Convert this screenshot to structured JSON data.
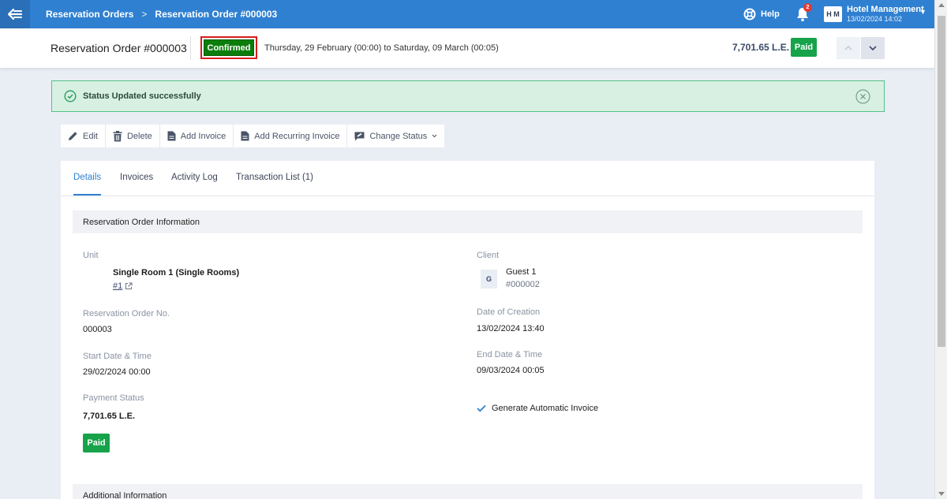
{
  "topbar": {
    "breadcrumbs": [
      "Reservation Orders",
      "Reservation Order #000003"
    ],
    "breadcrumb_separator": ">",
    "help_label": "Help",
    "notification_count": "2",
    "user_initials": "H M",
    "user_name": "Hotel Management",
    "user_datetime": "13/02/2024 14:02"
  },
  "header": {
    "title": "Reservation Order #000003",
    "status": "Confirmed",
    "date_range": "Thursday, 29 February (00:00) to Saturday, 09 March (00:05)",
    "total": "7,701.65 L.E.",
    "payment_badge": "Paid"
  },
  "alert": {
    "message": "Status Updated successfully"
  },
  "toolbar": {
    "edit": "Edit",
    "delete": "Delete",
    "add_invoice": "Add Invoice",
    "add_recurring_invoice": "Add Recurring Invoice",
    "change_status": "Change Status"
  },
  "tabs": [
    "Details",
    "Invoices",
    "Activity Log",
    "Transaction List (1)"
  ],
  "details": {
    "section_title": "Reservation Order Information",
    "unit_label": "Unit",
    "unit_name": "Single Room 1 (Single Rooms)",
    "unit_link": "#1",
    "client_label": "Client",
    "client_initial": "G",
    "client_name": "Guest 1",
    "client_id": "#000002",
    "order_no_label": "Reservation Order No.",
    "order_no": "000003",
    "creation_label": "Date of Creation",
    "creation_date": "13/02/2024 13:40",
    "start_label": "Start Date & Time",
    "start_date": "29/02/2024 00:00",
    "end_label": "End Date & Time",
    "end_date": "09/03/2024 00:05",
    "payment_status_label": "Payment Status",
    "payment_amount": "7,701.65 L.E.",
    "payment_badge": "Paid",
    "auto_invoice_label": "Generate Automatic Invoice",
    "additional_section_title": "Additional Information"
  },
  "colors": {
    "primary": "#2f80d1",
    "confirmed": "#0b7d0b",
    "paid": "#16a34a",
    "alert_bg": "#d7f0e2",
    "highlight_border": "#d61d1d"
  }
}
